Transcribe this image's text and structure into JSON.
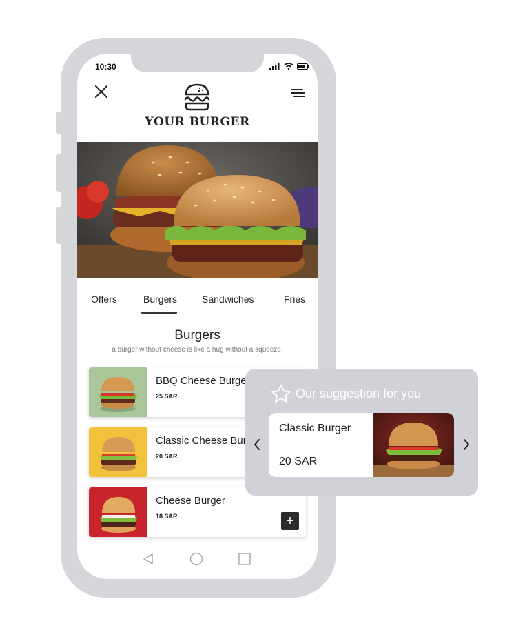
{
  "status_bar": {
    "time": "10:30"
  },
  "header": {
    "brand": "YOUR BURGER",
    "close_icon": "close-icon",
    "menu_icon": "menu-icon",
    "logo_icon": "burger-icon"
  },
  "tabs": [
    {
      "label": "Offers"
    },
    {
      "label": "Burgers",
      "active": true
    },
    {
      "label": "Sandwiches"
    },
    {
      "label": "Fries"
    }
  ],
  "section": {
    "title": "Burgers",
    "subtitle": "a burger without cheese is like a hug without a squeeze."
  },
  "menu_items": [
    {
      "name": "BBQ Cheese Burger",
      "price": "25 SAR",
      "bg": "#a9c79a"
    },
    {
      "name": "Classic Cheese Burger",
      "price": "20 SAR",
      "bg": "#f2c23c"
    },
    {
      "name": "Cheese Burger",
      "price": "18 SAR",
      "bg": "#c7242c",
      "add_label": "+"
    }
  ],
  "suggestion": {
    "title": "Our suggestion for you",
    "item_name": "Classic Burger",
    "item_price": "20 SAR",
    "prev_icon": "chevron-left-icon",
    "next_icon": "chevron-right-icon"
  },
  "colors": {
    "frame": "#d5d6da",
    "dark": "#2b2b2b",
    "popup": "#d1d2d7"
  }
}
